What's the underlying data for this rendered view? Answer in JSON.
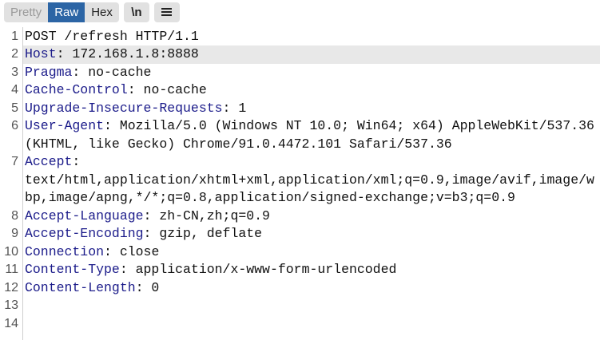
{
  "toolbar": {
    "tabs": [
      {
        "label": "Pretty",
        "state": "disabled"
      },
      {
        "label": "Raw",
        "state": "active"
      },
      {
        "label": "Hex",
        "state": "normal"
      }
    ],
    "newline_label": "\\n",
    "menu_icon": "hamburger-menu-icon"
  },
  "colors": {
    "active_tab": "#2c65a5",
    "header_key": "#1b1b8a",
    "highlight_row": "#e8e8e8"
  },
  "highlighted_line": 2,
  "lines": [
    {
      "num": "1",
      "key": "",
      "rows": [
        "POST /refresh HTTP/1.1"
      ]
    },
    {
      "num": "2",
      "key": "Host",
      "rows": [
        ": 172.168.1.8:8888"
      ]
    },
    {
      "num": "3",
      "key": "Pragma",
      "rows": [
        ": no-cache"
      ]
    },
    {
      "num": "4",
      "key": "Cache-Control",
      "rows": [
        ": no-cache"
      ]
    },
    {
      "num": "5",
      "key": "Upgrade-Insecure-Requests",
      "rows": [
        ": 1"
      ]
    },
    {
      "num": "6",
      "key": "User-Agent",
      "rows": [
        ": Mozilla/5.0 (Windows NT 10.0; Win64; x64) AppleWebKit/537.36",
        "(KHTML, like Gecko) Chrome/91.0.4472.101 Safari/537.36"
      ]
    },
    {
      "num": "7",
      "key": "Accept",
      "rows": [
        ":",
        "text/html,application/xhtml+xml,application/xml;q=0.9,image/avif,image/w",
        "bp,image/apng,*/*;q=0.8,application/signed-exchange;v=b3;q=0.9"
      ]
    },
    {
      "num": "8",
      "key": "Accept-Language",
      "rows": [
        ": zh-CN,zh;q=0.9"
      ]
    },
    {
      "num": "9",
      "key": "Accept-Encoding",
      "rows": [
        ": gzip, deflate"
      ]
    },
    {
      "num": "10",
      "key": "Connection",
      "rows": [
        ": close"
      ]
    },
    {
      "num": "11",
      "key": "Content-Type",
      "rows": [
        ": application/x-www-form-urlencoded"
      ]
    },
    {
      "num": "12",
      "key": "Content-Length",
      "rows": [
        ": 0"
      ]
    },
    {
      "num": "13",
      "key": "",
      "rows": [
        ""
      ]
    },
    {
      "num": "14",
      "key": "",
      "rows": [
        ""
      ]
    }
  ]
}
